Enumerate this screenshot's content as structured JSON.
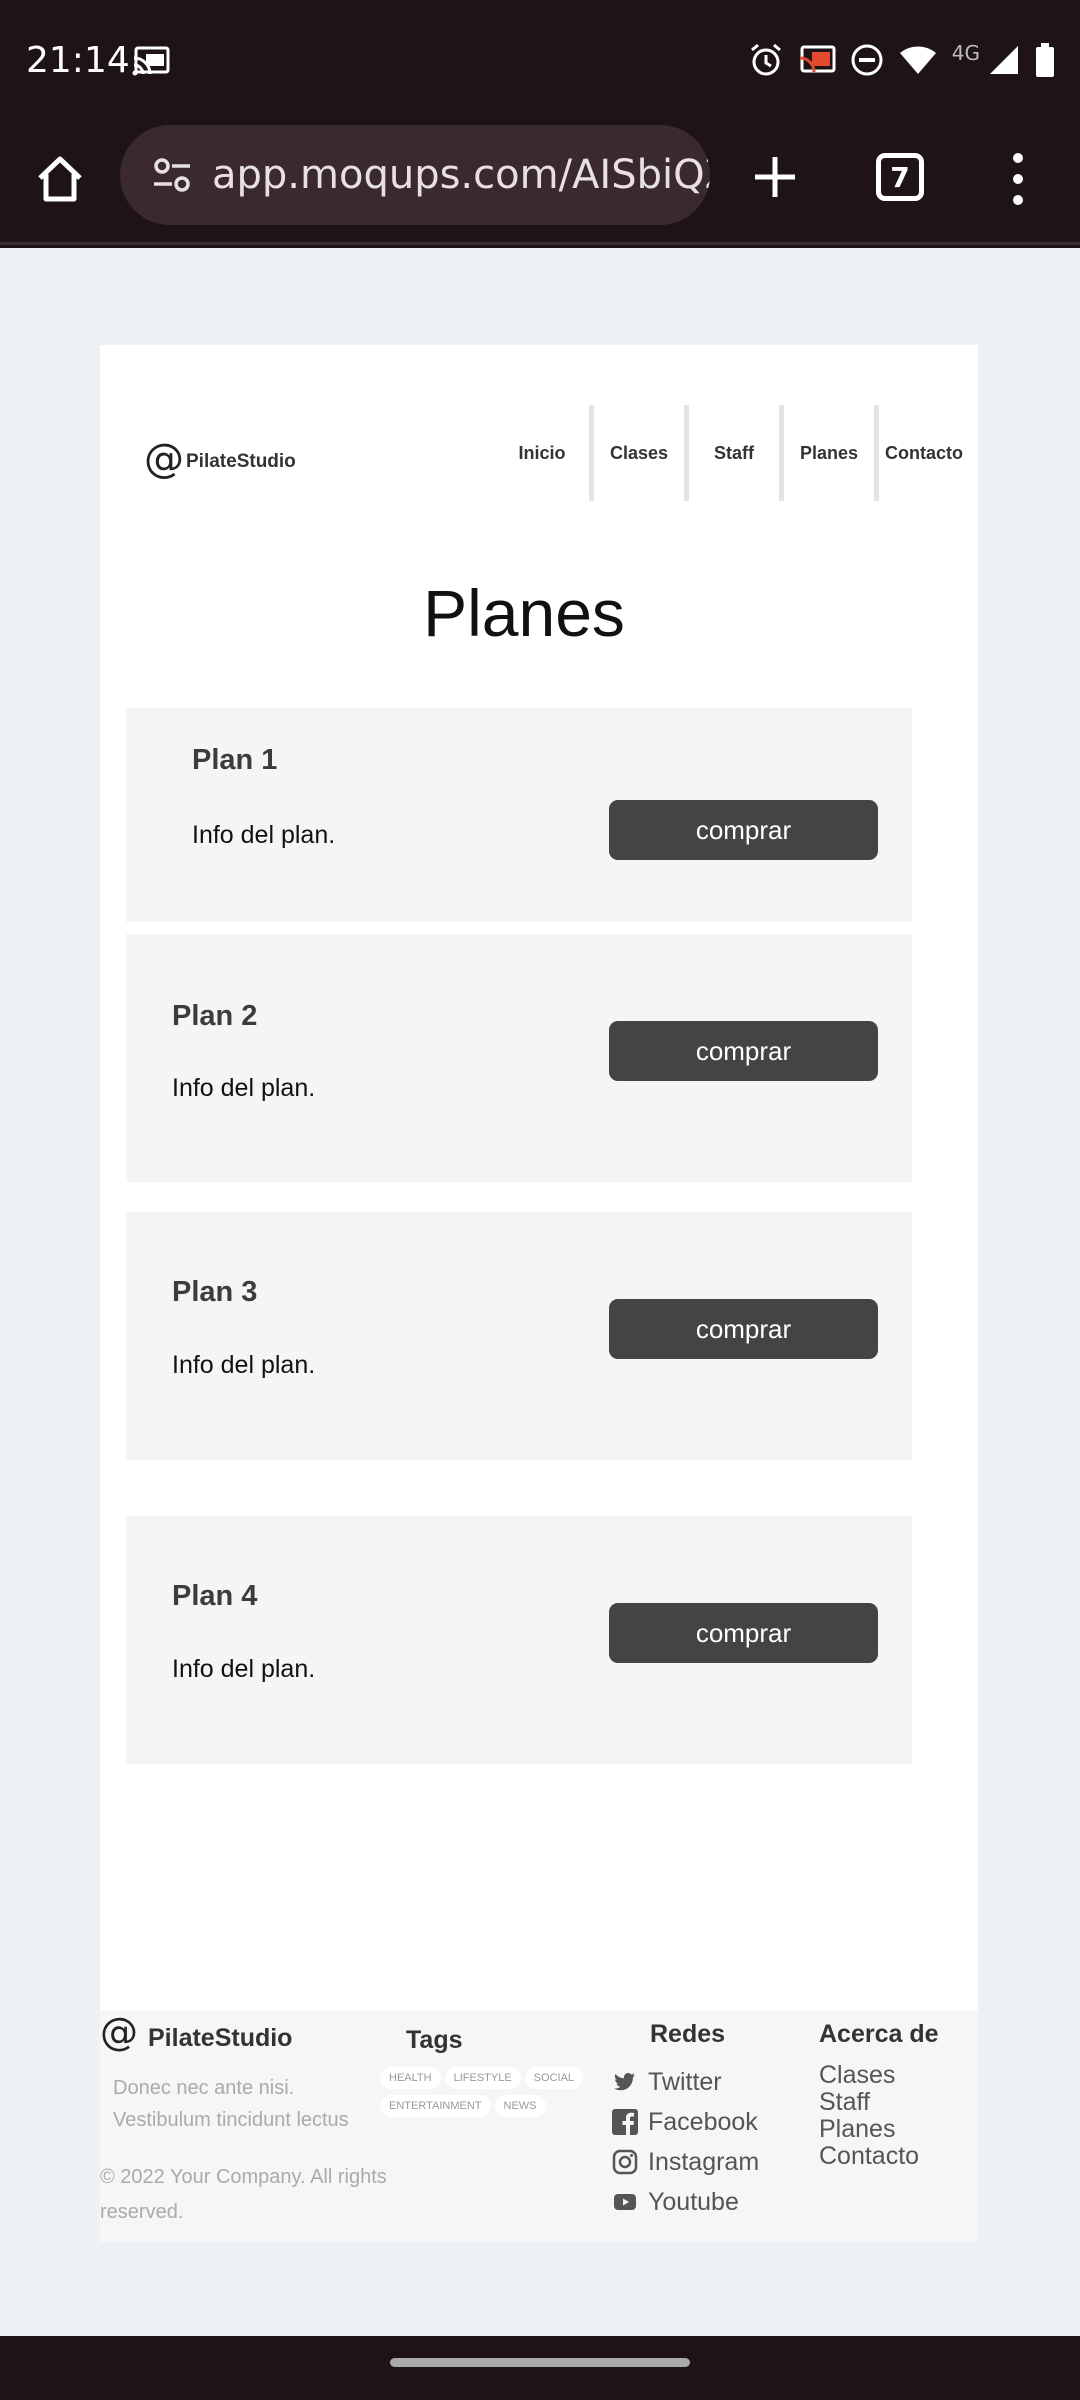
{
  "status_bar": {
    "time": "21:14",
    "network": "4G",
    "icons": [
      "cast-icon",
      "alarm-icon",
      "screen-cast-icon",
      "do-not-disturb-icon",
      "wifi-icon",
      "signal-icon",
      "battery-icon"
    ]
  },
  "browser": {
    "url": "app.moqups.com/AISbiQZS",
    "tab_count": "7",
    "colors": {
      "bar": "#1e1416",
      "pill": "#3a2a2d"
    }
  },
  "site": {
    "brand_symbol": "@",
    "brand_name": "PilateStudio",
    "nav": [
      "Inicio",
      "Clases",
      "Staff",
      "Planes",
      "Contacto"
    ],
    "title": "Planes",
    "plans": [
      {
        "title": "Plan 1",
        "info": "Info del plan.",
        "button": "comprar"
      },
      {
        "title": "Plan 2",
        "info": "Info del plan.",
        "button": "comprar"
      },
      {
        "title": "Plan 3",
        "info": "Info del plan.",
        "button": "comprar"
      },
      {
        "title": "Plan 4",
        "info": "Info del plan.",
        "button": "comprar"
      }
    ]
  },
  "footer": {
    "brand_symbol": "@",
    "brand_name": "PilateStudio",
    "description": "Donec nec ante nisi. Vestibulum tincidunt lectus sed",
    "copyright": "© 2022 Your Company.  All rights reserved.",
    "tags_title": "Tags",
    "tags": [
      "HEALTH",
      "LIFESTYLE",
      "SOCIAL",
      "ENTERTAINMENT",
      "NEWS"
    ],
    "social_title": "Redes",
    "social": [
      {
        "label": "Twitter",
        "icon": "twitter-icon"
      },
      {
        "label": "Facebook",
        "icon": "facebook-icon"
      },
      {
        "label": "Instagram",
        "icon": "instagram-icon"
      },
      {
        "label": "Youtube",
        "icon": "youtube-icon"
      }
    ],
    "about_title": "Acerca de",
    "about": [
      "Clases",
      "Staff",
      "Planes",
      "Contacto"
    ]
  }
}
